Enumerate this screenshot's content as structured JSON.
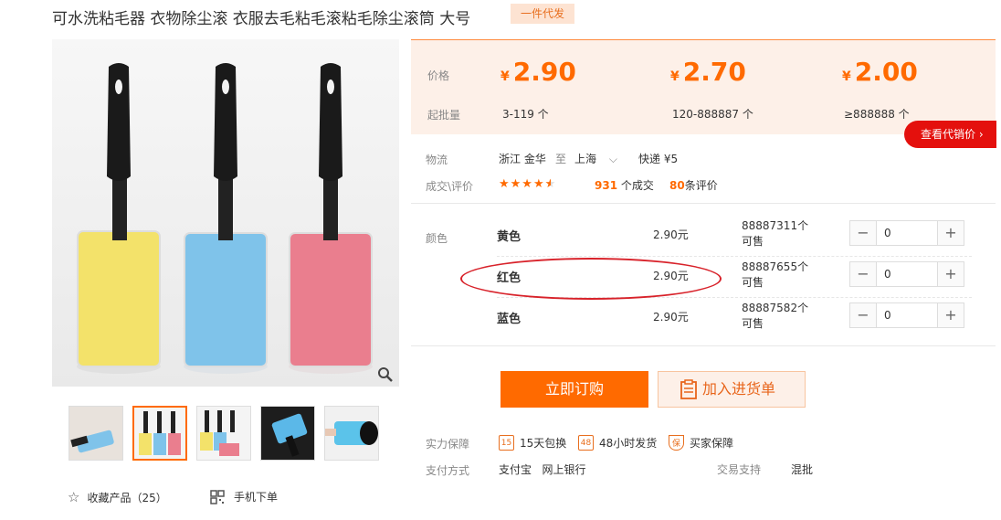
{
  "product": {
    "title": "可水洗粘毛器 衣物除尘滚 衣服去毛粘毛滚粘毛除尘滚筒 大号",
    "badge": "一件代发"
  },
  "price_panel": {
    "price_label": "价格",
    "qty_label": "起批量",
    "currency": "¥",
    "tiers": [
      {
        "price": "2.90",
        "qty": "3-119 个"
      },
      {
        "price": "2.70",
        "qty": "120-888887 个"
      },
      {
        "price": "2.00",
        "qty": "≥888888 个"
      }
    ],
    "agent_button": "查看代销价 ›"
  },
  "logistics": {
    "label": "物流",
    "from": "浙江 金华",
    "to_word": "至",
    "to": "上海",
    "shipping": "快递 ¥5"
  },
  "deals": {
    "label": "成交\\评价",
    "rating": 4.5,
    "deal_count": "931",
    "deal_text": "个成交",
    "review_count": "80",
    "review_text": "条评价"
  },
  "sku": {
    "label": "颜色",
    "rows": [
      {
        "name": "黄色",
        "price": "2.90元",
        "stock": "88887311个可售",
        "qty": "0"
      },
      {
        "name": "红色",
        "price": "2.90元",
        "stock": "88887655个可售",
        "qty": "0"
      },
      {
        "name": "蓝色",
        "price": "2.90元",
        "stock": "88887582个可售",
        "qty": "0"
      }
    ]
  },
  "actions": {
    "buy": "立即订购",
    "cart": "加入进货单"
  },
  "guarantee": {
    "label": "实力保障",
    "items": [
      "15天包换",
      "48小时发货",
      "买家保障"
    ],
    "icons": [
      "15",
      "48",
      "保"
    ]
  },
  "payment": {
    "label": "支付方式",
    "methods": "支付宝   网上银行",
    "trade_label": "交易支持",
    "trade_value": "混批"
  },
  "footer": {
    "favorite": "收藏产品（25）",
    "mobile": "手机下单"
  },
  "colors": {
    "accent": "#ff6a00",
    "panel": "#fdf0e8",
    "red": "#e4100d"
  }
}
